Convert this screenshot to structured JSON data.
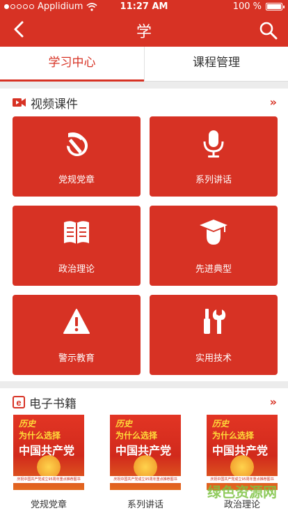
{
  "status": {
    "carrier": "Applidium",
    "time": "11:27 AM",
    "battery": "100 %",
    "battery_level": 1.0
  },
  "nav": {
    "title": "学"
  },
  "tabs": [
    {
      "label": "学习中心",
      "active": true
    },
    {
      "label": "课程管理",
      "active": false
    }
  ],
  "video_section": {
    "title": "视频课件",
    "more": "»",
    "tiles": [
      {
        "label": "党规党章",
        "icon": "hammer-sickle-icon"
      },
      {
        "label": "系列讲话",
        "icon": "microphone-icon"
      },
      {
        "label": "政治理论",
        "icon": "book-icon"
      },
      {
        "label": "先进典型",
        "icon": "graduate-icon"
      },
      {
        "label": "警示教育",
        "icon": "warning-icon"
      },
      {
        "label": "实用技术",
        "icon": "tools-icon"
      }
    ]
  },
  "book_section": {
    "title": "电子书籍",
    "more": "»",
    "books": [
      {
        "caption": "党规党章",
        "cover_line1": "历史",
        "cover_line2a": "为什么",
        "cover_line2b": "选择",
        "cover_line3": "中国共产党",
        "cover_strip": "庆祝中国共产党成立95周年重点推荐图书"
      },
      {
        "caption": "系列讲话",
        "cover_line1": "历史",
        "cover_line2a": "为什么",
        "cover_line2b": "选择",
        "cover_line3": "中国共产党",
        "cover_strip": "庆祝中国共产党成立95周年重点推荐图书"
      },
      {
        "caption": "政治理论",
        "cover_line1": "历史",
        "cover_line2a": "为什么",
        "cover_line2b": "选择",
        "cover_line3": "中国共产党",
        "cover_strip": "庆祝中国共产党成立95周年重点推荐图书"
      }
    ]
  },
  "watermark": "绿色资源网",
  "colors": {
    "accent": "#d73224",
    "background": "#ececec"
  }
}
